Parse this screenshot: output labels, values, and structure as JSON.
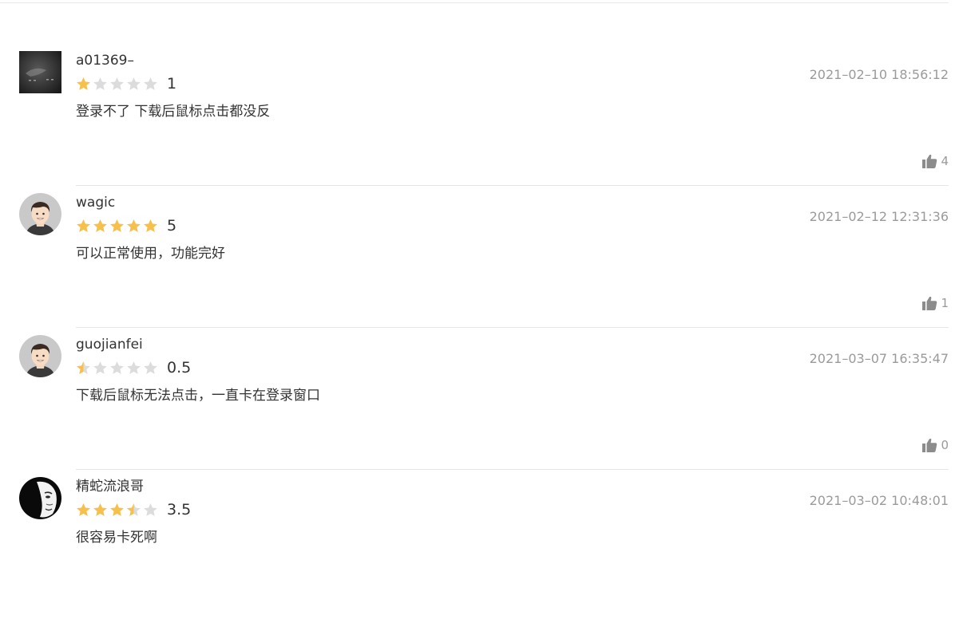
{
  "reviews": [
    {
      "username": "a01369–",
      "avatar": "dark-photo-avatar",
      "rating": 1,
      "rating_text": "1",
      "comment": "登录不了 下载后鼠标点击都没反",
      "timestamp": "2021–02–10 18:56:12",
      "likes": "4"
    },
    {
      "username": "wagic",
      "avatar": "default-male-avatar",
      "rating": 5,
      "rating_text": "5",
      "comment": "可以正常使用，功能完好",
      "timestamp": "2021–02–12 12:31:36",
      "likes": "1"
    },
    {
      "username": "guojianfei",
      "avatar": "default-male-avatar",
      "rating": 0.5,
      "rating_text": "0.5",
      "comment": "下载后鼠标无法点击，一直卡在登录窗口",
      "timestamp": "2021–03–07 16:35:47",
      "likes": "0"
    },
    {
      "username": "精蛇流浪哥",
      "avatar": "black-white-face-avatar",
      "rating": 3.5,
      "rating_text": "3.5",
      "comment": "很容易卡死啊",
      "timestamp": "2021–03–02 10:48:01",
      "likes": ""
    }
  ],
  "colors": {
    "star_filled": "#f7c04a",
    "star_empty": "#dcdcdc",
    "muted_text": "#9a9a9a",
    "thumb_icon": "#8c8c8c"
  }
}
